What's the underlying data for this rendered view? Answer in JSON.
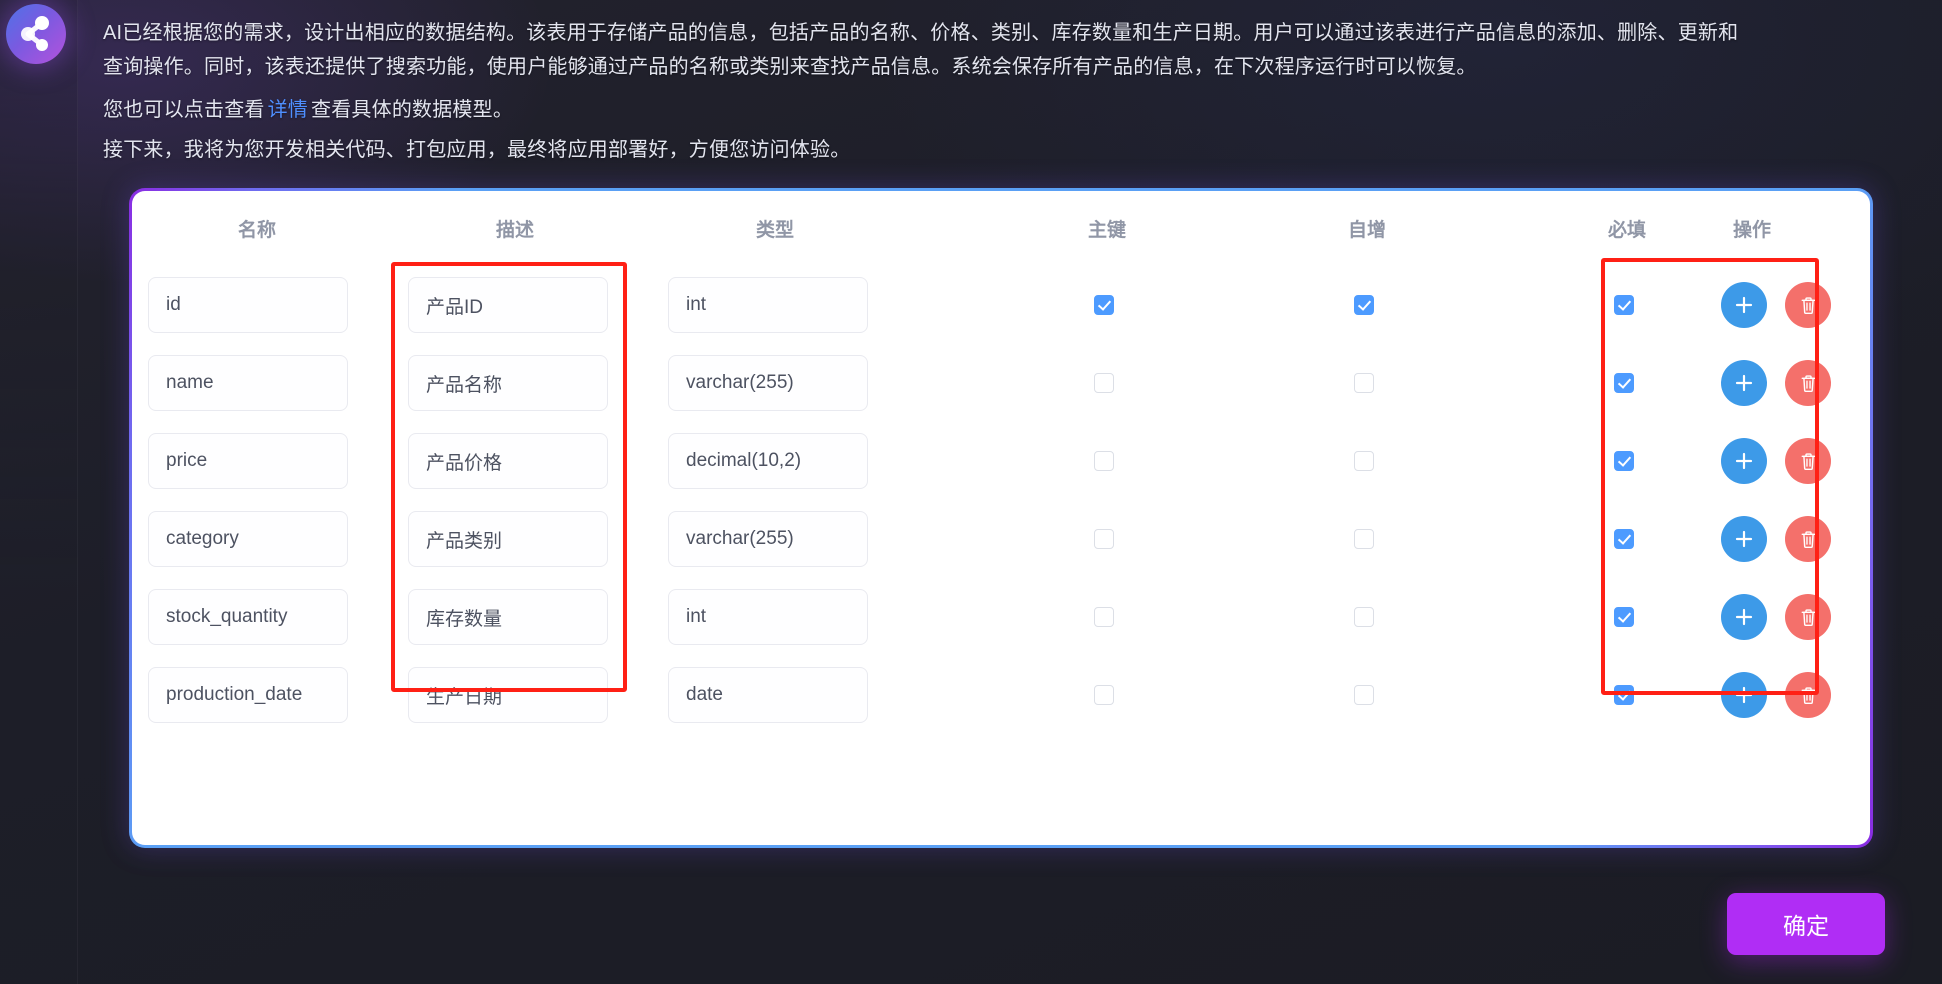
{
  "avatar": {
    "icon": "assistant-logo-icon"
  },
  "message": {
    "paragraph1_part1": "AI已经根据您的需求，设计出相应的数据结构。该表用于存储产品的信息，包括产品的名称、价格、类别、库存数量和生产日期。用户可以通过该表进行产品信息的添加、删除、更新和查询操作。同时，该表还提供了搜索功能，使用户能够通过产品的名称或类别来查找产品信息。系统会保存所有产品的信息，在下次程序运行时可以恢复。",
    "paragraph2_prefix": "您也可以点击查看",
    "paragraph2_link": "详情",
    "paragraph2_suffix": "查看具体的数据模型。",
    "paragraph3": "接下来，我将为您开发相关代码、打包应用，最终将应用部署好，方便您访问体验。"
  },
  "table": {
    "headers": {
      "name": "名称",
      "description": "描述",
      "type": "类型",
      "primary_key": "主键",
      "auto_increment": "自增",
      "required": "必填",
      "operation": "操作"
    },
    "rows": [
      {
        "name": "id",
        "description": "产品ID",
        "type": "int",
        "primary_key": true,
        "auto_increment": true,
        "required": true
      },
      {
        "name": "name",
        "description": "产品名称",
        "type": "varchar(255)",
        "primary_key": false,
        "auto_increment": false,
        "required": true
      },
      {
        "name": "price",
        "description": "产品价格",
        "type": "decimal(10,2)",
        "primary_key": false,
        "auto_increment": false,
        "required": true
      },
      {
        "name": "category",
        "description": "产品类别",
        "type": "varchar(255)",
        "primary_key": false,
        "auto_increment": false,
        "required": true
      },
      {
        "name": "stock_quantity",
        "description": "库存数量",
        "type": "int",
        "primary_key": false,
        "auto_increment": false,
        "required": true
      },
      {
        "name": "production_date",
        "description": "生产日期",
        "type": "date",
        "primary_key": false,
        "auto_increment": false,
        "required": true
      }
    ],
    "row_actions": {
      "add": "plus-icon",
      "delete": "trash-icon"
    }
  },
  "annotations": [
    {
      "target": "description-column",
      "color": "#ff2015"
    },
    {
      "target": "operation-column",
      "color": "#ff2015"
    }
  ],
  "footer": {
    "confirm_label": "确定"
  },
  "colors": {
    "accent_purple": "#b02df5",
    "accent_blue": "#4d9bff",
    "add_button": "#3d9ae8",
    "delete_button": "#f4706b",
    "annotation_red": "#ff2015",
    "link_blue": "#4f8fff",
    "background": "#1c1d26",
    "card_background": "#ffffff"
  }
}
